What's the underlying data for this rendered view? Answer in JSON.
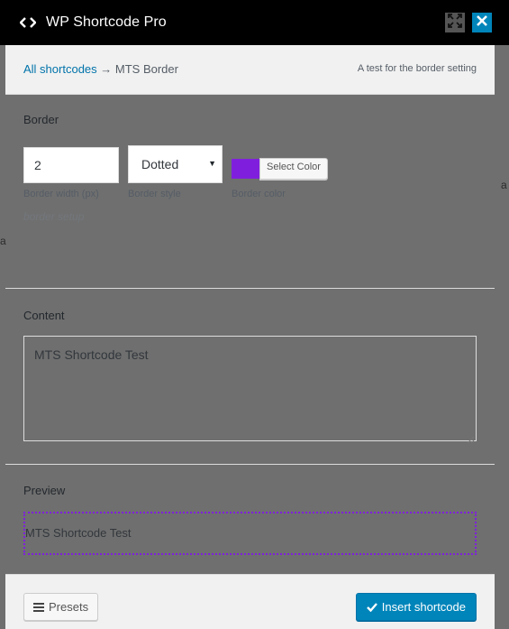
{
  "app": {
    "title": "WP Shortcode Pro"
  },
  "background": {
    "frag_right": "a",
    "frag_left": "a"
  },
  "breadcrumb": {
    "root_link": "All shortcodes",
    "separator": " → ",
    "current": "MTS Border"
  },
  "header": {
    "description": "A test for the border setting"
  },
  "border_section": {
    "label": "Border",
    "width": {
      "value": "2",
      "hint": "Border width (px)"
    },
    "style": {
      "selected": "Dotted",
      "hint": "Border style"
    },
    "color": {
      "value": "#7f1fdd",
      "button_label": "Select Color",
      "hint": "Border color"
    },
    "description": "border setup"
  },
  "content_section": {
    "label": "Content",
    "value": "MTS Shortcode Test"
  },
  "preview_section": {
    "label": "Preview",
    "text": "MTS Shortcode Test"
  },
  "footer": {
    "presets_label": "Presets",
    "insert_label": "Insert shortcode"
  },
  "icons": {
    "title": "code-icon",
    "expand": "expand-icon",
    "close": "close-icon",
    "presets": "menu-icon",
    "insert": "checkmark-icon"
  },
  "colors": {
    "accent": "#0085ba",
    "border_color": "#7f1fdd",
    "titlebar": "#000000"
  }
}
